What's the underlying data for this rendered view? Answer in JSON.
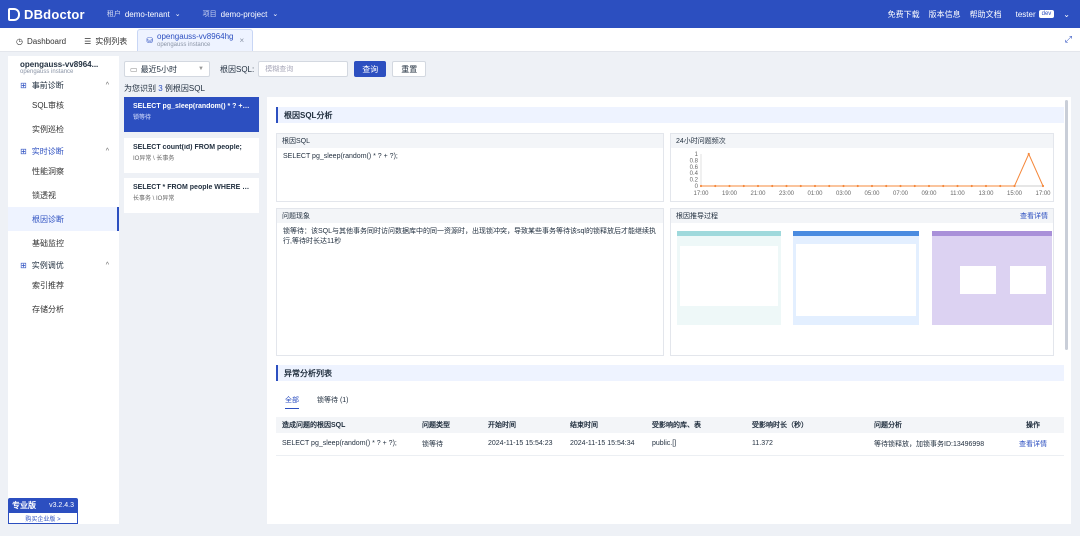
{
  "topbar": {
    "logo": "DBdoctor",
    "tenant_key": "租户",
    "tenant_value": "demo-tenant",
    "project_key": "项目",
    "project_value": "demo-project",
    "links": [
      "免费下载",
      "版本信息",
      "帮助文档"
    ],
    "user": "tester",
    "user_badge": "dev"
  },
  "tabs": [
    {
      "label": "Dashboard",
      "icon": "dashboard-icon"
    },
    {
      "label": "实例列表",
      "icon": "list-icon"
    },
    {
      "label": "opengauss-vv8964hg",
      "sub": "opengauss instance",
      "icon": "database-icon"
    }
  ],
  "sidebar": {
    "instance_name": "opengauss-vv8964...",
    "instance_type": "opengauss instance",
    "groups": [
      {
        "label": "事前诊断",
        "items": [
          "SQL审核",
          "实例巡检"
        ]
      },
      {
        "label": "实时诊断",
        "items": [
          "性能洞察",
          "锁透视",
          "根因诊断",
          "基础监控"
        ]
      },
      {
        "label": "实例调优",
        "items": [
          "索引推荐",
          "存储分析"
        ]
      }
    ],
    "edition": "专业版",
    "version": "v3.2.4.3",
    "buy": "购买企业版 >"
  },
  "filters": {
    "time_range": "最近5小时",
    "root_sql_label": "根因SQL:",
    "root_sql_placeholder": "模糊查询",
    "query_btn": "查询",
    "reset_btn": "重置"
  },
  "summary": {
    "prefix": "为您识别",
    "count": "3",
    "suffix": "例根因SQL"
  },
  "sql_cards": [
    {
      "sql": "SELECT pg_sleep(random() * ? + ?);",
      "tags": "锁等待"
    },
    {
      "sql": "SELECT count(id) FROM people;",
      "tags": "IO异常 \\ 长事务"
    },
    {
      "sql": "SELECT * FROM people WHERE ag...",
      "tags": "长事务 \\ IO异常"
    }
  ],
  "analysis": {
    "title": "根因SQL分析",
    "root_sql_title": "根因SQL",
    "root_sql": "SELECT pg_sleep(random() * ? + ?);",
    "freq_title": "24小时问题频次",
    "phenomenon_title": "问题现象",
    "phenomenon": "锁等待：该SQL与其他事务同时访问数据库中的同一资源时，出现锁冲突，导致某些事务等待该sql的锁释放后才能继续执行,等待时长达11秒",
    "process_title": "根因推导过程",
    "process_link": "查看详情"
  },
  "chart_data": {
    "type": "line",
    "title": "24小时问题频次",
    "x": [
      "17:00",
      "18:00",
      "19:00",
      "20:00",
      "21:00",
      "22:00",
      "23:00",
      "00:00",
      "01:00",
      "02:00",
      "03:00",
      "04:00",
      "05:00",
      "06:00",
      "07:00",
      "08:00",
      "09:00",
      "10:00",
      "11:00",
      "12:00",
      "13:00",
      "14:00",
      "15:00",
      "16:00",
      "17:00"
    ],
    "x_tick_labels": [
      "17:00",
      "19:00",
      "21:00",
      "23:00",
      "01:00",
      "03:00",
      "05:00",
      "07:00",
      "09:00",
      "11:00",
      "13:00",
      "15:00",
      "17:00"
    ],
    "series": [
      {
        "values": [
          0,
          0,
          0,
          0,
          0,
          0,
          0,
          0,
          0,
          0,
          0,
          0,
          0,
          0,
          0,
          0,
          0,
          0,
          0,
          0,
          0,
          0,
          0,
          1,
          0
        ],
        "color": "#f5883b"
      }
    ],
    "y_ticks": [
      "0",
      "0.2",
      "0.4",
      "0.6",
      "0.8",
      "1"
    ],
    "ylim": [
      0,
      1
    ]
  },
  "anomaly": {
    "title": "异常分析列表",
    "filter_tabs": [
      "全部",
      "锁等待 (1)"
    ],
    "columns": [
      "造成问题的根因SQL",
      "问题类型",
      "开始时间",
      "结束时间",
      "受影响的库、表",
      "受影响时长（秒）",
      "问题分析",
      "操作"
    ],
    "rows": [
      [
        "SELECT pg_sleep(random() * ? + ?);",
        "锁等待",
        "2024-11-15 15:54:23",
        "2024-11-15 15:54:34",
        "public.[]",
        "11.372",
        "等待锁释放，加锁事务ID:13496998",
        "查看详情"
      ]
    ]
  }
}
